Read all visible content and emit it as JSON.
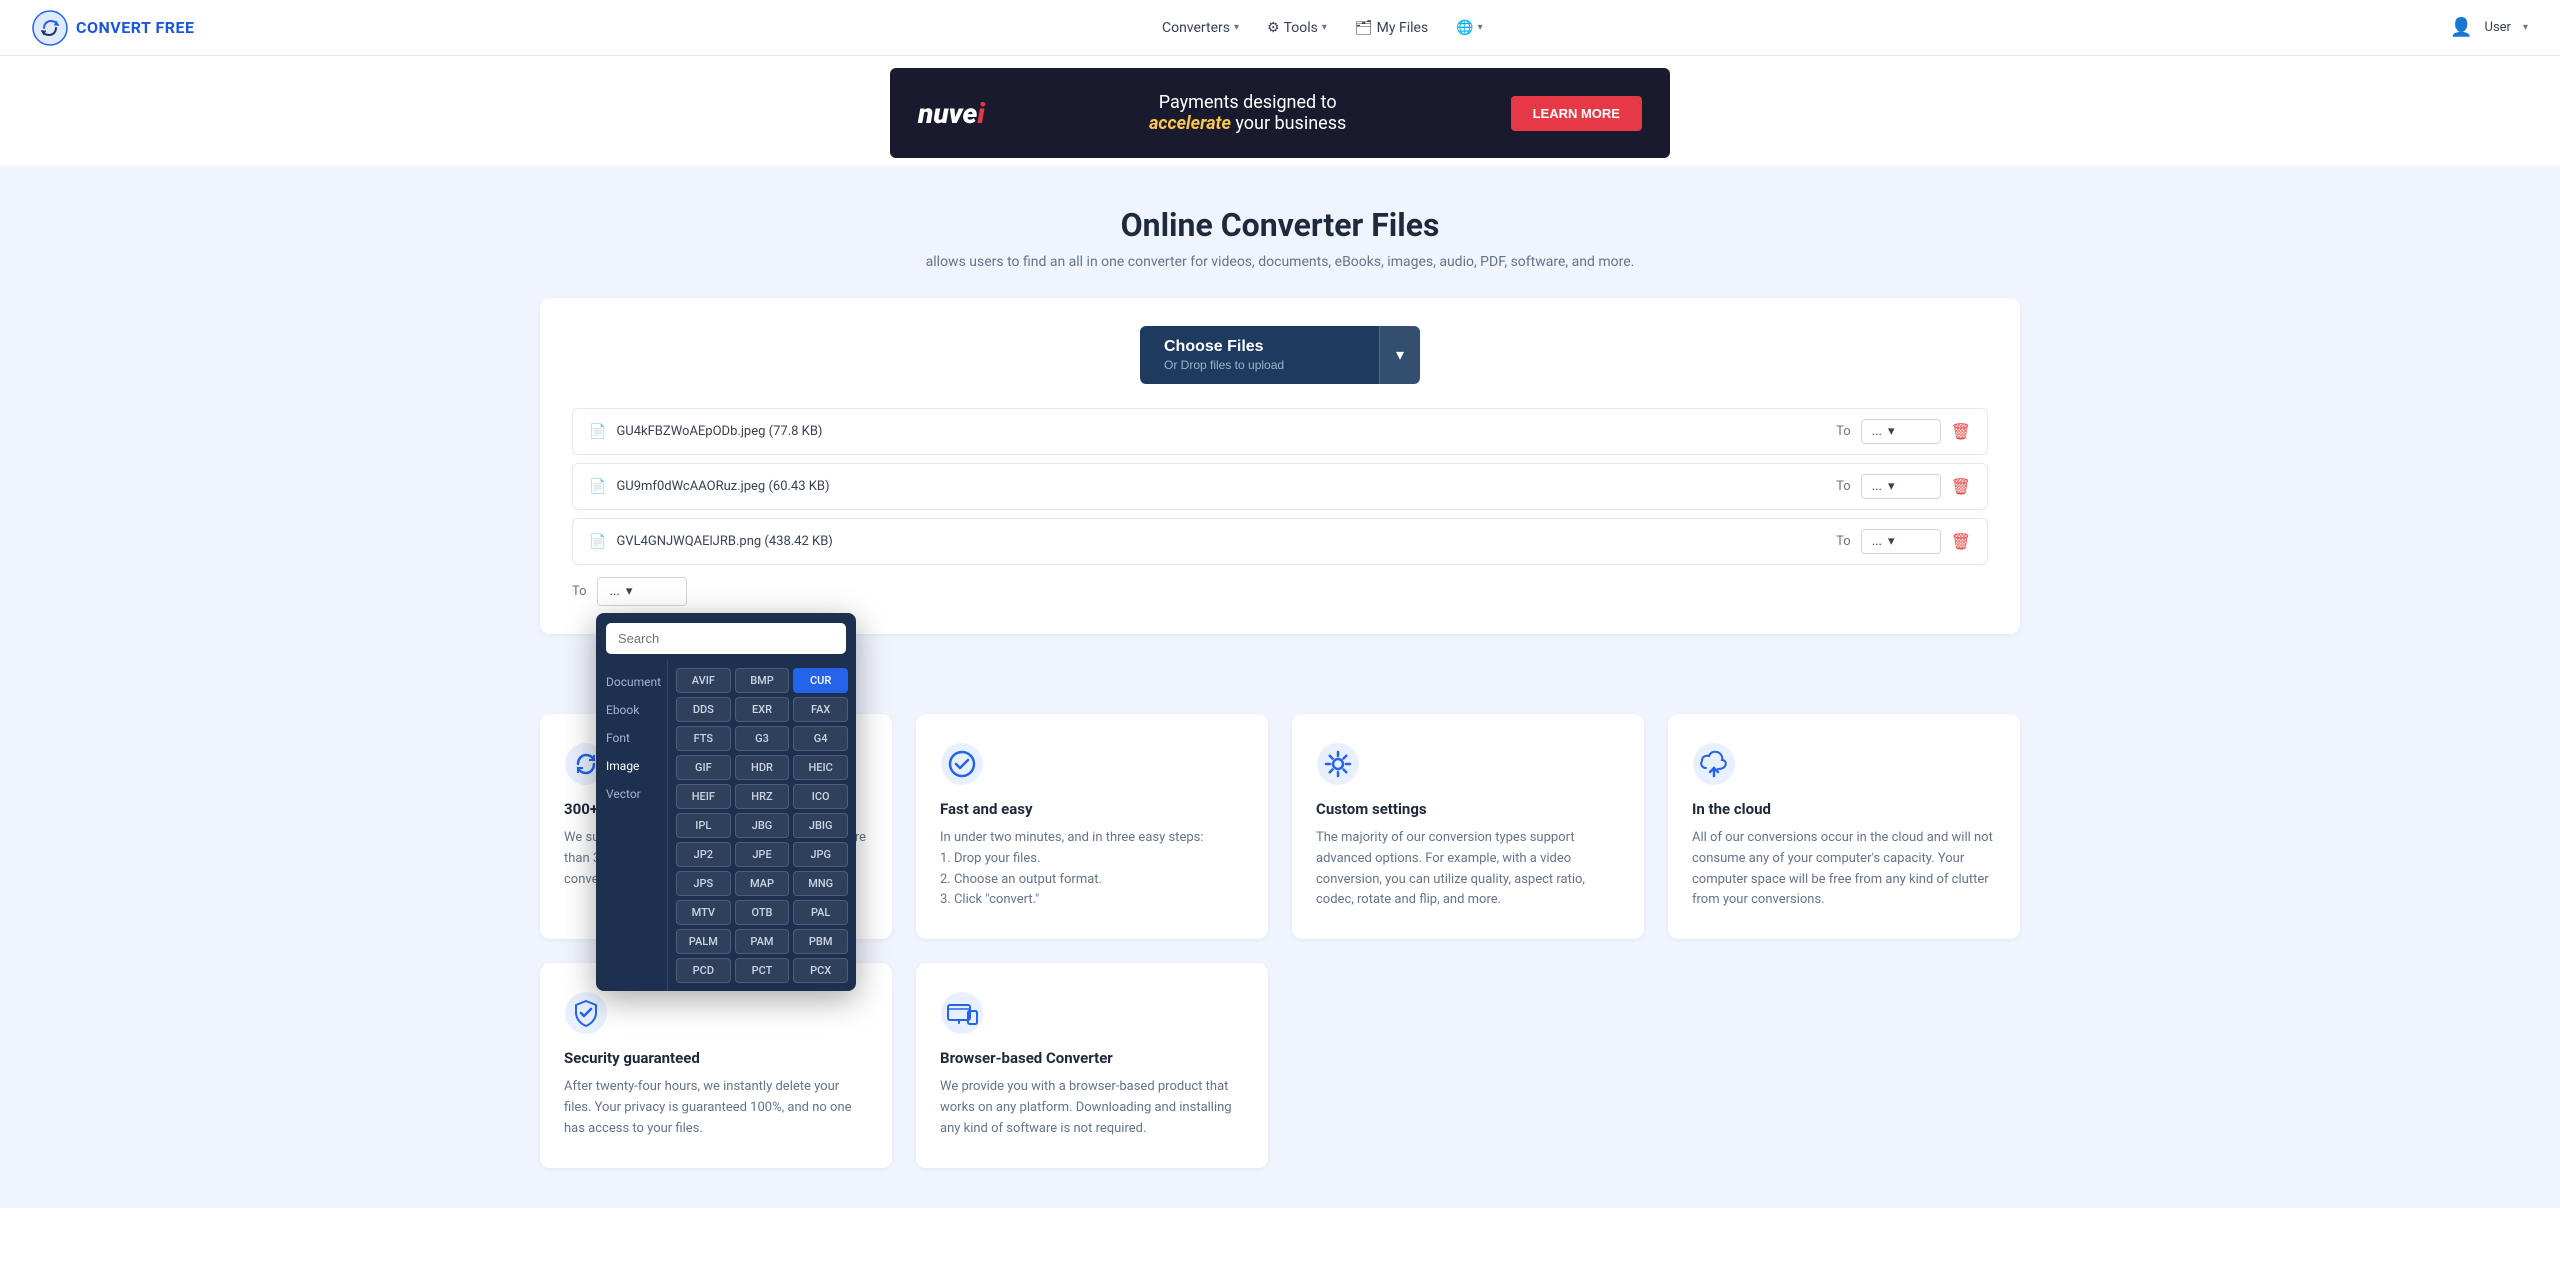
{
  "brand": {
    "name": "CONVERT FREE",
    "logo_alt": "Convert Free Logo"
  },
  "navbar": {
    "converters_label": "Converters",
    "tools_label": "Tools",
    "my_files_label": "My Files",
    "language_label": "",
    "user_name": "User"
  },
  "ad": {
    "logo": "nuvei",
    "logo_accent": ".",
    "headline": "Payments designed to",
    "headline_italic": "accelerate",
    "headline_rest": "your business",
    "cta": "LEARN MORE"
  },
  "hero": {
    "title": "Online Converter Files",
    "subtitle": "allows users to find an all in one converter for videos, documents, eBooks, images, audio, PDF, software, and more."
  },
  "upload": {
    "choose_label": "Choose Files",
    "drop_label": "Or Drop files to upload",
    "chevron": "▾"
  },
  "files": [
    {
      "name": "GU4kFBZWoAEpODb.jpeg",
      "size": "77.8 KB"
    },
    {
      "name": "GU9mf0dWcAAORuz.jpeg",
      "size": "60.43 KB"
    },
    {
      "name": "GVL4GNJWQAElJRB.png",
      "size": "438.42 KB"
    }
  ],
  "to_placeholders": [
    "...",
    "...",
    "..."
  ],
  "format_dropdown": {
    "search_placeholder": "Search",
    "categories": [
      "Document",
      "Ebook",
      "Font",
      "Image",
      "Vector"
    ],
    "formats": [
      "AVIF",
      "BMP",
      "CUR",
      "DDS",
      "EXR",
      "FAX",
      "FTS",
      "G3",
      "G4",
      "GIF",
      "HDR",
      "HEIC",
      "HEIF",
      "HRZ",
      "ICO",
      "IPL",
      "JBG",
      "JBIG",
      "JP2",
      "JPE",
      "JPG",
      "JPS",
      "MAP",
      "MNG",
      "MTV",
      "OTB",
      "PAL",
      "PALM",
      "PAM",
      "PBM",
      "PCD",
      "PCT",
      "PCX"
    ],
    "highlighted": "CUR"
  },
  "features": [
    {
      "icon": "refresh-icon",
      "title": "300+ formats supported",
      "desc": "We support more than 25,000 conversions and more than 300 file formats -- more than any other converter out there."
    },
    {
      "icon": "check-icon",
      "title": "Fast and easy",
      "desc": "In under two minutes, and in three easy steps:\n1. Drop your files.\n2. Choose an output format.\n3. Click \"convert.\""
    },
    {
      "icon": "gear-icon",
      "title": "Custom settings",
      "desc": "The majority of our conversion types support advanced options. For example, with a video conversion, you can utilize quality, aspect ratio, codec, rotate and flip, and more."
    },
    {
      "icon": "cloud-upload-icon",
      "title": "In the cloud",
      "desc": "All of our conversions occur in the cloud and will not consume any of your computer's capacity. Your computer space will be free from any kind of clutter from your conversions."
    },
    {
      "icon": "shield-icon",
      "title": "Security guaranteed",
      "desc": "After twenty-four hours, we instantly delete your files. Your privacy is guaranteed 100%, and no one has access to your files."
    },
    {
      "icon": "devices-icon",
      "title": "Browser-based Converter",
      "desc": "We provide you with a browser-based product that works on any platform. Downloading and installing any kind of software is not required."
    }
  ],
  "colors": {
    "primary": "#1e3a5f",
    "accent": "#2563eb",
    "danger": "#ef4444",
    "bg": "#f0f4ff"
  }
}
